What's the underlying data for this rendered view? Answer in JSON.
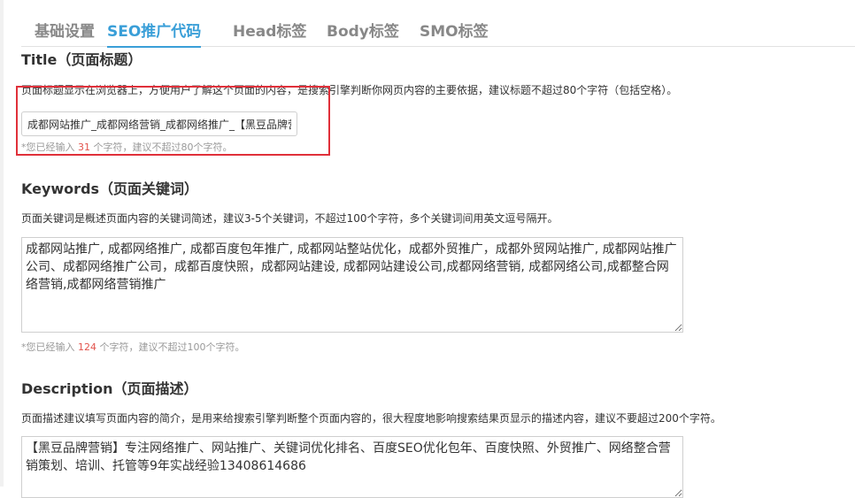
{
  "tabs": [
    {
      "label": "基础设置"
    },
    {
      "label": "SEO推广代码"
    },
    {
      "label": "Head标签"
    },
    {
      "label": "Body标签"
    },
    {
      "label": "SMO标签"
    }
  ],
  "title_section": {
    "heading": "Title（页面标题）",
    "description": "页面标题显示在浏览器上，方便用户了解这个页面的内容，是搜索引擎判断你网页内容的主要依据，建议标题不超过80个字符（包括空格）。",
    "value": "成都网站推广_成都网络营销_成都网络推广_【黑豆品牌营销】",
    "count_prefix": "*您已经输入 ",
    "count": "31",
    "count_suffix": " 个字符，建议不超过80个字符。"
  },
  "keywords_section": {
    "heading": "Keywords（页面关键词）",
    "description": "页面关键词是概述页面内容的关键词简述，建议3-5个关键词，不超过100个字符，多个关键词间用英文逗号隔开。",
    "value": "成都网站推广, 成都网络推广, 成都百度包年推广, 成都网站整站优化，成都外贸推广，成都外贸网站推广, 成都网站推广公司、成都网络推广公司，成都百度快照，成都网站建设, 成都网站建设公司,成都网络营销, 成都网络公司,成都整合网络营销,成都网络营销推广",
    "count_prefix": "*您已经输入 ",
    "count": "124",
    "count_suffix": " 个字符，建议不超过100个字符。"
  },
  "description_section": {
    "heading": "Description（页面描述）",
    "description": "页面描述建议填写页面内容的简介，是用来给搜索引擎判断整个页面内容的，很大程度地影响搜索结果页显示的描述内容，建议不要超过200个字符。",
    "value": "【黑豆品牌营销】专注网络推广、网站推广、关键词优化排名、百度SEO优化包年、百度快照、外贸推广、网络整合营销策划、培训、托管等9年实战经验13408614686"
  },
  "colors": {
    "accent": "#3a9fd8",
    "highlight": "#e0303a",
    "count_number": "#e2534c"
  }
}
